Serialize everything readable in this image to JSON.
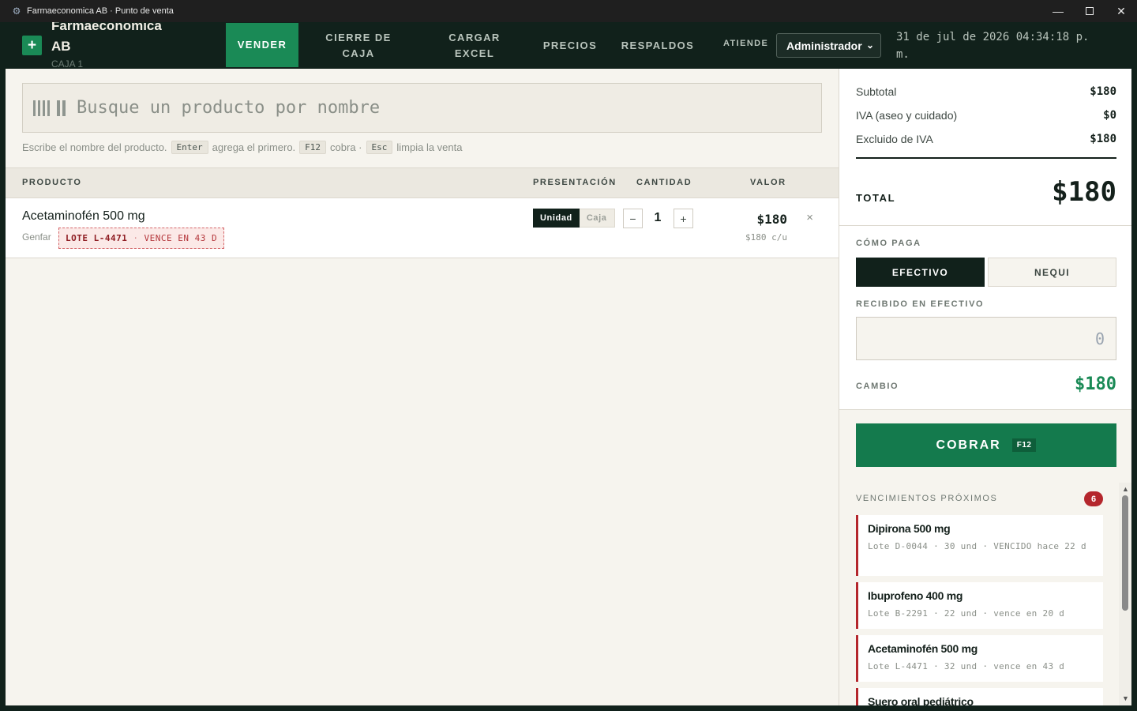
{
  "window": {
    "title": "Farmaeconomica AB · Punto de venta"
  },
  "header": {
    "brand_line1": "Farmaeconomica",
    "brand_line2": "AB",
    "caja": "CAJA 1",
    "nav": [
      {
        "label": "VENDER",
        "active": true
      },
      {
        "label": "CIERRE DE CAJA",
        "active": false
      },
      {
        "label": "CARGAR EXCEL",
        "active": false
      },
      {
        "label": "PRECIOS",
        "active": false
      },
      {
        "label": "RESPALDOS",
        "active": false
      }
    ],
    "atiende_label": "ATIENDE",
    "user": "Administrador",
    "clock": "31 de jul de 2026 04:34:18 p. m."
  },
  "search": {
    "placeholder": "Busque un producto por nombre",
    "hint_1": "Escribe el nombre del producto.",
    "key_enter": "Enter",
    "hint_2": "agrega el primero.",
    "key_f12": "F12",
    "hint_3": "cobra ·",
    "key_esc": "Esc",
    "hint_4": "limpia la venta"
  },
  "table": {
    "headers": {
      "producto": "PRODUCTO",
      "presentacion": "PRESENTACIÓN",
      "cantidad": "CANTIDAD",
      "valor": "VALOR"
    },
    "rows": [
      {
        "name": "Acetaminofén 500 mg",
        "lab": "Genfar",
        "lote": "LOTE L-4471",
        "vence": "VENCE EN 43 D",
        "pres_unidad": "Unidad",
        "pres_caja": "Caja",
        "qty": "1",
        "valor": "$180",
        "valor_unit": "$180 c/u",
        "remove": "×"
      }
    ]
  },
  "totals": {
    "subtotal_label": "Subtotal",
    "subtotal": "$180",
    "iva_label": "IVA (aseo y cuidado)",
    "iva": "$0",
    "excluido_label": "Excluido de IVA",
    "excluido": "$180",
    "total_label": "TOTAL",
    "total": "$180"
  },
  "payment": {
    "label": "CÓMO PAGA",
    "efectivo": "EFECTIVO",
    "nequi": "NEQUI",
    "selected": "EFECTIVO",
    "recibido_label": "RECIBIDO EN EFECTIVO",
    "recibido_placeholder": "0",
    "cambio_label": "CAMBIO",
    "cambio": "$180",
    "cobrar_label": "COBRAR",
    "cobrar_key": "F12"
  },
  "vencimientos": {
    "label": "VENCIMIENTOS PRÓXIMOS",
    "count": "6",
    "items": [
      {
        "name": "Dipirona 500 mg",
        "detail": "Lote D-0044 · 30 und · VENCIDO hace 22 d"
      },
      {
        "name": "Ibuprofeno 400 mg",
        "detail": "Lote B-2291 · 22 und · vence en 20 d"
      },
      {
        "name": "Acetaminofén 500 mg",
        "detail": "Lote L-4471 · 32 und · vence en 43 d"
      },
      {
        "name": "Suero oral pediátrico",
        "detail": ""
      }
    ]
  },
  "colors": {
    "header_bg": "#11211b",
    "accent_green": "#1a8a56",
    "alert_red": "#b4262c",
    "panel_bg": "#f6f4ee"
  }
}
